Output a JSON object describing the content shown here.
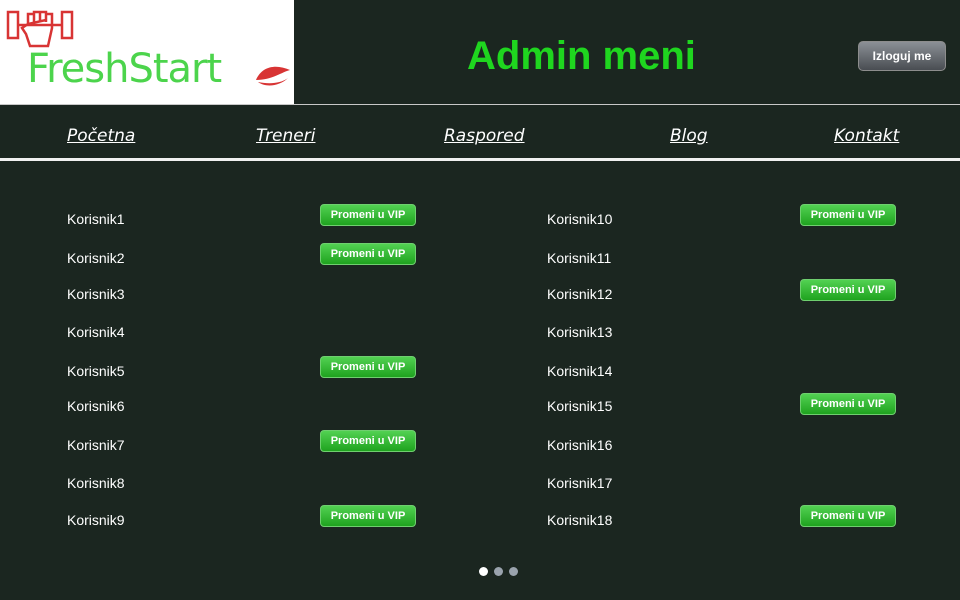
{
  "header": {
    "logo_text": "FreshStart",
    "title": "Admin meni",
    "logout_label": "Izloguj me"
  },
  "nav": [
    "Početna",
    "Treneri",
    "Raspored",
    "Blog",
    "Kontakt"
  ],
  "users_left": [
    {
      "name": "Korisnik1",
      "vip_button": true
    },
    {
      "name": "Korisnik2",
      "vip_button": true
    },
    {
      "name": "Korisnik3",
      "vip_button": false
    },
    {
      "name": "Korisnik4",
      "vip_button": false
    },
    {
      "name": "Korisnik5",
      "vip_button": true
    },
    {
      "name": "Korisnik6",
      "vip_button": false
    },
    {
      "name": "Korisnik7",
      "vip_button": true
    },
    {
      "name": "Korisnik8",
      "vip_button": false
    },
    {
      "name": "Korisnik9",
      "vip_button": true
    }
  ],
  "users_right": [
    {
      "name": "Korisnik10",
      "vip_button": true
    },
    {
      "name": "Korisnik11",
      "vip_button": false
    },
    {
      "name": "Korisnik12",
      "vip_button": true
    },
    {
      "name": "Korisnik13",
      "vip_button": false
    },
    {
      "name": "Korisnik14",
      "vip_button": false
    },
    {
      "name": "Korisnik15",
      "vip_button": true
    },
    {
      "name": "Korisnik16",
      "vip_button": false
    },
    {
      "name": "Korisnik17",
      "vip_button": false
    },
    {
      "name": "Korisnik18",
      "vip_button": true
    }
  ],
  "vip_label": "Promeni u VIP",
  "pagination": {
    "pages": 3,
    "active": 1
  },
  "colors": {
    "background": "#1b2620",
    "title_green": "#1fd61f",
    "logo_green": "#4cd44c",
    "logo_red": "#d83434",
    "vip_green": "#2eb82e"
  }
}
